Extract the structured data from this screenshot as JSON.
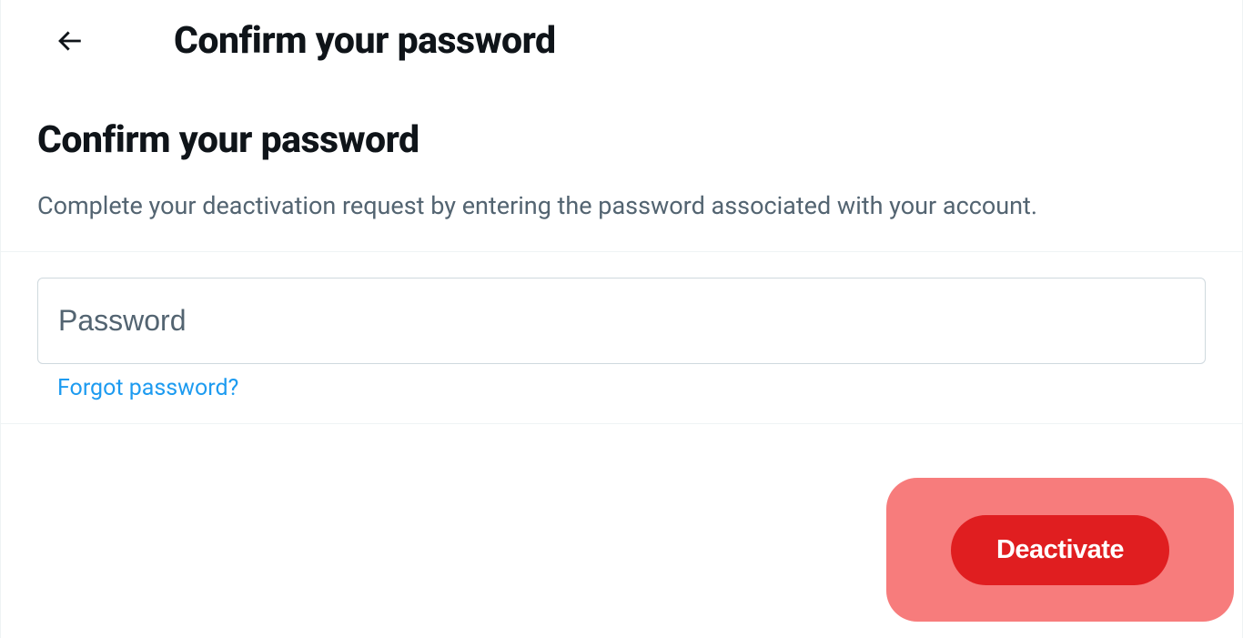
{
  "header": {
    "title": "Confirm your password"
  },
  "section": {
    "title": "Confirm your password",
    "description": "Complete your deactivation request by entering the password associated with your account."
  },
  "form": {
    "password_placeholder": "Password",
    "password_value": "",
    "forgot_link": "Forgot password?"
  },
  "actions": {
    "deactivate_label": "Deactivate"
  }
}
